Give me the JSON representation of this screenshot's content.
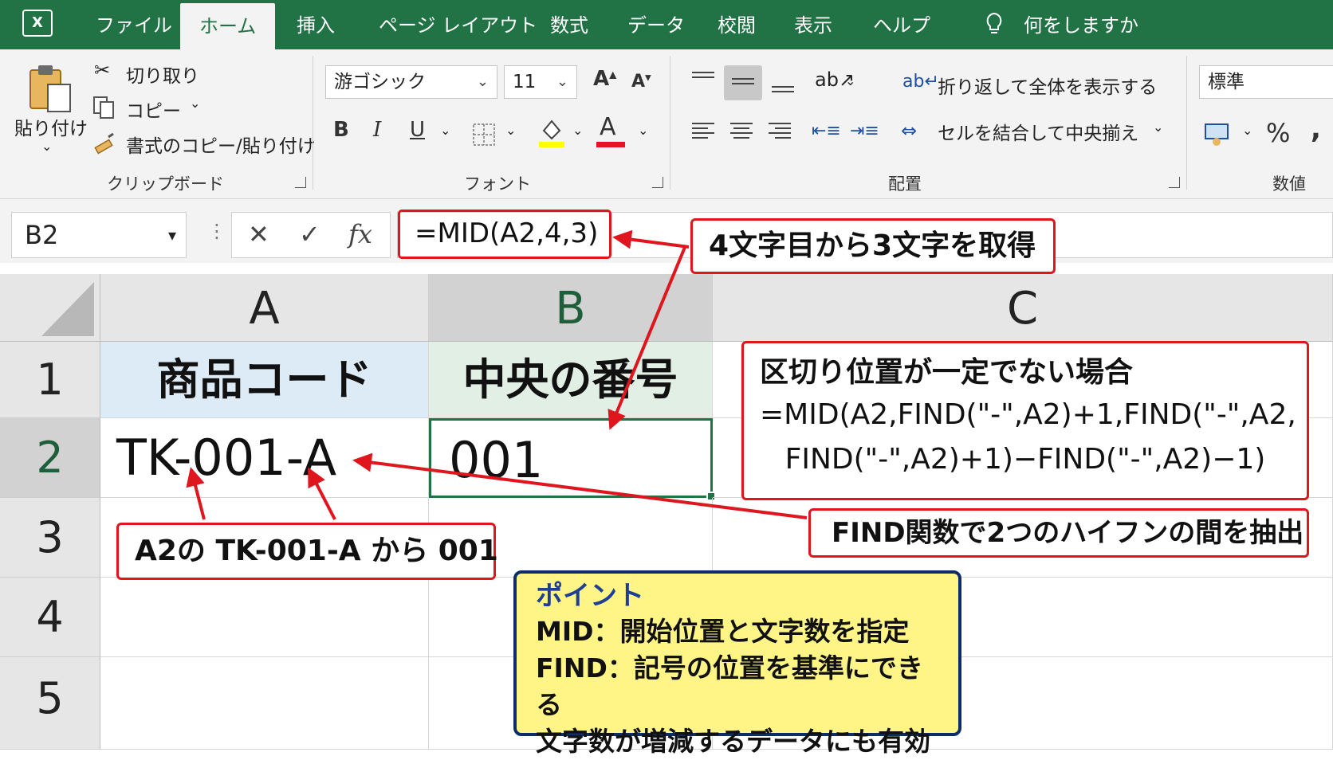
{
  "app": {
    "icon_label": "X"
  },
  "tabs": [
    "ファイル",
    "ホーム",
    "挿入",
    "ページ レイアウト",
    "数式",
    "データ",
    "校閲",
    "表示",
    "ヘルプ"
  ],
  "tell_me": "何をしますか",
  "ribbon": {
    "clipboard": {
      "paste": "貼り付け",
      "cut": "切り取り",
      "copy": "コピー",
      "format_painter": "書式のコピー/貼り付け",
      "label": "クリップボード"
    },
    "font": {
      "name": "游ゴシック",
      "size": "11",
      "label": "フォント",
      "bold": "B",
      "italic": "I",
      "underline": "U",
      "grow": "A",
      "shrink": "A",
      "color_a": "A"
    },
    "alignment": {
      "wrap": "折り返して全体を表示する",
      "merge": "セルを結合して中央揃え",
      "label": "配置"
    },
    "number": {
      "format": "標準",
      "percent": "%",
      "comma": ",",
      "label": "数値"
    }
  },
  "formula_bar": {
    "name_box": "B2",
    "cancel": "✕",
    "enter": "✓",
    "fx": "fx",
    "formula": "=MID(A2,4,3)"
  },
  "columns": [
    "A",
    "B",
    "C"
  ],
  "rows": [
    "1",
    "2",
    "3",
    "4",
    "5"
  ],
  "cells": {
    "A1": "商品コード",
    "B1": "中央の番号",
    "A2": "TK-001-A",
    "B2": "001"
  },
  "annotations": {
    "formula_note": "4文字目から3文字を取得",
    "alt_title": "区切り位置が一定でない場合",
    "alt_line1": "=MID(A2,FIND(\"-\",A2)+1,FIND(\"-\",A2,",
    "alt_line2": "FIND(\"-\",A2)+1)−FIND(\"-\",A2)−1)",
    "find_note": "FIND関数で2つのハイフンの間を抽出",
    "a2_note": "A2の TK-001-A から 001",
    "point_title": "ポイント",
    "point_lines": [
      "MID：開始位置と文字数を指定",
      "FIND：記号の位置を基準にできる",
      "文字数が増減するデータにも有効"
    ]
  },
  "colors": {
    "excel_green": "#217346",
    "callout_red": "#e0161e",
    "point_yellow": "#fff586",
    "point_border": "#0b2d6a",
    "a1_fill": "#ddebf7",
    "b1_fill": "#e2efe5"
  }
}
